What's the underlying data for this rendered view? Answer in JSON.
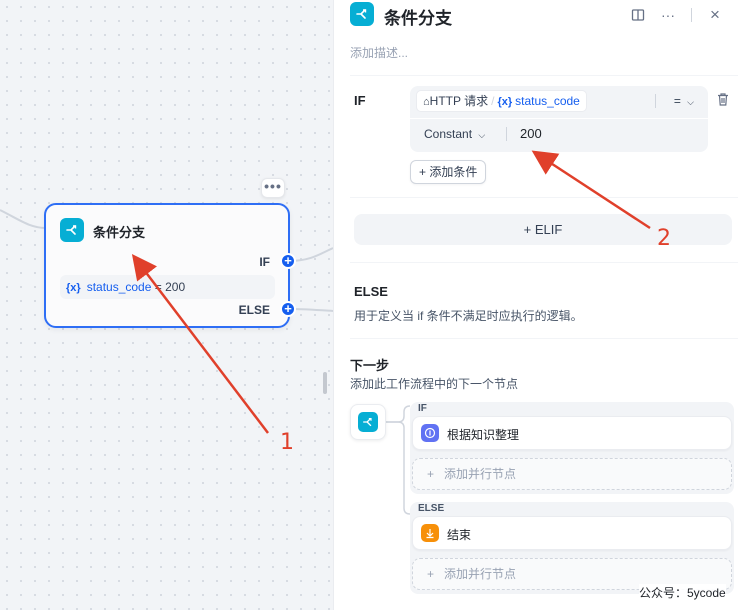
{
  "colors": {
    "accent": "#155eef",
    "node_border": "#2e6ef5",
    "if_else_icon_bg": "#06aed4",
    "knowledge_icon_bg": "#6172f3",
    "end_icon_bg": "#f79009",
    "annotation": "#e0402b"
  },
  "canvas": {
    "node": {
      "more_label": "•••",
      "icon": "branch-icon",
      "title": "条件分支",
      "if_label": "IF",
      "else_label": "ELSE",
      "condition": {
        "var_symbol": "{x}",
        "var_name": "status_code",
        "operator": "=",
        "value": "200"
      },
      "handle_plus": "+"
    },
    "annotations": {
      "label_1": "1",
      "label_2": "2"
    }
  },
  "panel": {
    "title": "条件分支",
    "icon": "branch-icon",
    "actions": {
      "layout_icon": "book-open-icon",
      "more_label": "···",
      "close_label": "×"
    },
    "description_placeholder": "添加描述...",
    "if_section": {
      "label": "IF",
      "condition": {
        "node_icon": "home-icon",
        "node_name": "HTTP 请求",
        "separator": "/",
        "var_symbol": "{x}",
        "var_name": "status_code",
        "operator": "=",
        "type": "Constant",
        "value": "200"
      },
      "add_condition_label": "+ 添加条件"
    },
    "elif_label": "+ ELIF",
    "else_section": {
      "title": "ELSE",
      "description": "用于定义当 if 条件不满足时应执行的逻辑。"
    },
    "next_step": {
      "title": "下一步",
      "description": "添加此工作流程中的下一个节点",
      "branches": [
        {
          "label": "IF",
          "node_label": "根据知识整理",
          "node_icon": "knowledge-icon",
          "add_parallel_label": "添加并行节点"
        },
        {
          "label": "ELSE",
          "node_label": "结束",
          "node_icon": "end-icon",
          "add_parallel_label": "添加并行节点"
        }
      ]
    }
  },
  "watermark": "公众号：5ycode"
}
